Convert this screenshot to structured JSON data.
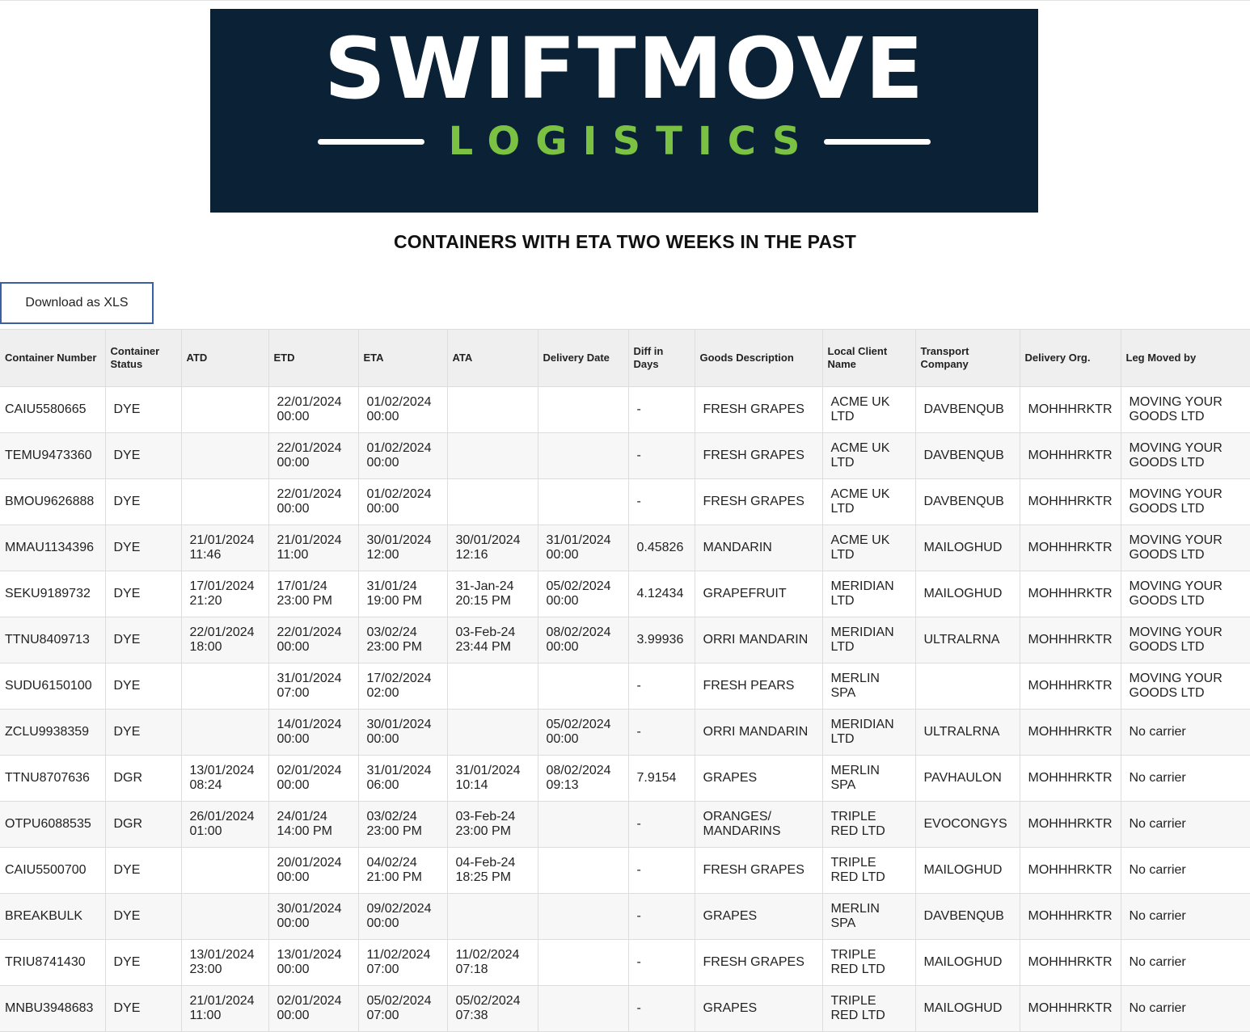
{
  "header": {
    "brand_name": "SWIFTMOVE",
    "brand_sub": "LOGISTICS",
    "title": "CONTAINERS WITH ETA TWO WEEKS IN THE PAST",
    "download_label": "Download as XLS"
  },
  "table": {
    "columns": [
      "Container Number",
      "Container Status",
      "ATD",
      "ETD",
      "ETA",
      "ATA",
      "Delivery Date",
      "Diff in Days",
      "Goods Description",
      "Local Client Name",
      "Transport Company",
      "Delivery Org.",
      "Leg Moved by"
    ],
    "rows": [
      [
        "CAIU5580665",
        "DYE",
        "",
        "22/01/2024\n00:00",
        "01/02/2024\n00:00",
        "",
        "",
        "-",
        "FRESH GRAPES",
        "ACME UK\nLTD",
        "DAVBENQUB",
        "MOHHHRKTR",
        "MOVING YOUR\nGOODS LTD"
      ],
      [
        "TEMU9473360",
        "DYE",
        "",
        "22/01/2024\n00:00",
        "01/02/2024\n00:00",
        "",
        "",
        "-",
        "FRESH GRAPES",
        "ACME UK\nLTD",
        "DAVBENQUB",
        "MOHHHRKTR",
        "MOVING YOUR\nGOODS LTD"
      ],
      [
        "BMOU9626888",
        "DYE",
        "",
        "22/01/2024\n00:00",
        "01/02/2024\n00:00",
        "",
        "",
        "-",
        "FRESH GRAPES",
        "ACME UK\nLTD",
        "DAVBENQUB",
        "MOHHHRKTR",
        "MOVING YOUR\nGOODS LTD"
      ],
      [
        "MMAU1134396",
        "DYE",
        "21/01/2024\n11:46",
        "21/01/2024\n11:00",
        "30/01/2024\n12:00",
        "30/01/2024\n12:16",
        "31/01/2024\n00:00",
        "0.45826",
        "MANDARIN",
        "ACME UK\nLTD",
        "MAILOGHUD",
        "MOHHHRKTR",
        "MOVING YOUR\nGOODS LTD"
      ],
      [
        "SEKU9189732",
        "DYE",
        "17/01/2024\n21:20",
        "17/01/24\n23:00 PM",
        "31/01/24\n19:00 PM",
        "31-Jan-24\n20:15 PM",
        "05/02/2024\n00:00",
        "4.12434",
        "GRAPEFRUIT",
        "MERIDIAN\nLTD",
        "MAILOGHUD",
        "MOHHHRKTR",
        "MOVING YOUR\nGOODS LTD"
      ],
      [
        "TTNU8409713",
        "DYE",
        "22/01/2024\n18:00",
        "22/01/2024\n00:00",
        "03/02/24\n23:00 PM",
        "03-Feb-24\n23:44 PM",
        "08/02/2024\n00:00",
        "3.99936",
        "ORRI MANDARIN",
        "MERIDIAN\nLTD",
        "ULTRALRNA",
        "MOHHHRKTR",
        "MOVING YOUR\nGOODS LTD"
      ],
      [
        "SUDU6150100",
        "DYE",
        "",
        "31/01/2024\n07:00",
        "17/02/2024\n02:00",
        "",
        "",
        "-",
        "FRESH PEARS",
        "MERLIN\nSPA",
        "",
        "MOHHHRKTR",
        "MOVING YOUR\nGOODS LTD"
      ],
      [
        "ZCLU9938359",
        "DYE",
        "",
        "14/01/2024\n00:00",
        "30/01/2024\n00:00",
        "",
        "05/02/2024\n00:00",
        "-",
        "ORRI MANDARIN",
        "MERIDIAN\nLTD",
        "ULTRALRNA",
        "MOHHHRKTR",
        "No carrier"
      ],
      [
        "TTNU8707636",
        "DGR",
        "13/01/2024\n08:24",
        "02/01/2024\n00:00",
        "31/01/2024\n06:00",
        "31/01/2024\n10:14",
        "08/02/2024\n09:13",
        "7.9154",
        "GRAPES",
        "MERLIN\nSPA",
        "PAVHAULON",
        "MOHHHRKTR",
        "No carrier"
      ],
      [
        "OTPU6088535",
        "DGR",
        "26/01/2024\n01:00",
        "24/01/24\n14:00 PM",
        "03/02/24\n23:00 PM",
        "03-Feb-24\n23:00 PM",
        "",
        "-",
        "ORANGES/\nMANDARINS",
        "TRIPLE\nRED LTD",
        "EVOCONGYS",
        "MOHHHRKTR",
        "No carrier"
      ],
      [
        "CAIU5500700",
        "DYE",
        "",
        "20/01/2024\n00:00",
        "04/02/24\n21:00 PM",
        "04-Feb-24\n18:25 PM",
        "",
        "-",
        "FRESH GRAPES",
        "TRIPLE\nRED LTD",
        "MAILOGHUD",
        "MOHHHRKTR",
        "No carrier"
      ],
      [
        "BREAKBULK",
        "DYE",
        "",
        "30/01/2024\n00:00",
        "09/02/2024\n00:00",
        "",
        "",
        "-",
        "GRAPES",
        "MERLIN\nSPA",
        "DAVBENQUB",
        "MOHHHRKTR",
        "No carrier"
      ],
      [
        "TRIU8741430",
        "DYE",
        "13/01/2024\n23:00",
        "13/01/2024\n00:00",
        "11/02/2024\n07:00",
        "11/02/2024\n07:18",
        "",
        "-",
        "FRESH GRAPES",
        "TRIPLE\nRED LTD",
        "MAILOGHUD",
        "MOHHHRKTR",
        "No carrier"
      ],
      [
        "MNBU3948683",
        "DYE",
        "21/01/2024\n11:00",
        "02/01/2024\n00:00",
        "05/02/2024\n07:00",
        "05/02/2024\n07:38",
        "",
        "-",
        "GRAPES",
        "TRIPLE\nRED LTD",
        "MAILOGHUD",
        "MOHHHRKTR",
        "No carrier"
      ]
    ]
  }
}
